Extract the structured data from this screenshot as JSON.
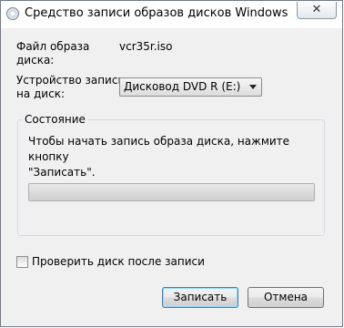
{
  "window": {
    "title": "Средство записи образов дисков Windows",
    "close_glyph": "✕",
    "icon": "disc-burner-icon"
  },
  "form": {
    "image_file_label_line1": "Файл образа",
    "image_file_label_line2": "диска:",
    "image_file_value": "vcr35r.iso",
    "device_label_line1": "Устройство записи",
    "device_label_line2": "на диск:",
    "device_selected": "Дисковод DVD R (E:)"
  },
  "status": {
    "caption": "Состояние",
    "message": "Чтобы начать запись образа диска, нажмите кнопку\n\"Записать\".",
    "progress_fraction": 0
  },
  "verify": {
    "label": "Проверить диск после записи",
    "checked": false
  },
  "buttons": {
    "burn": "Записать",
    "cancel": "Отмена"
  }
}
